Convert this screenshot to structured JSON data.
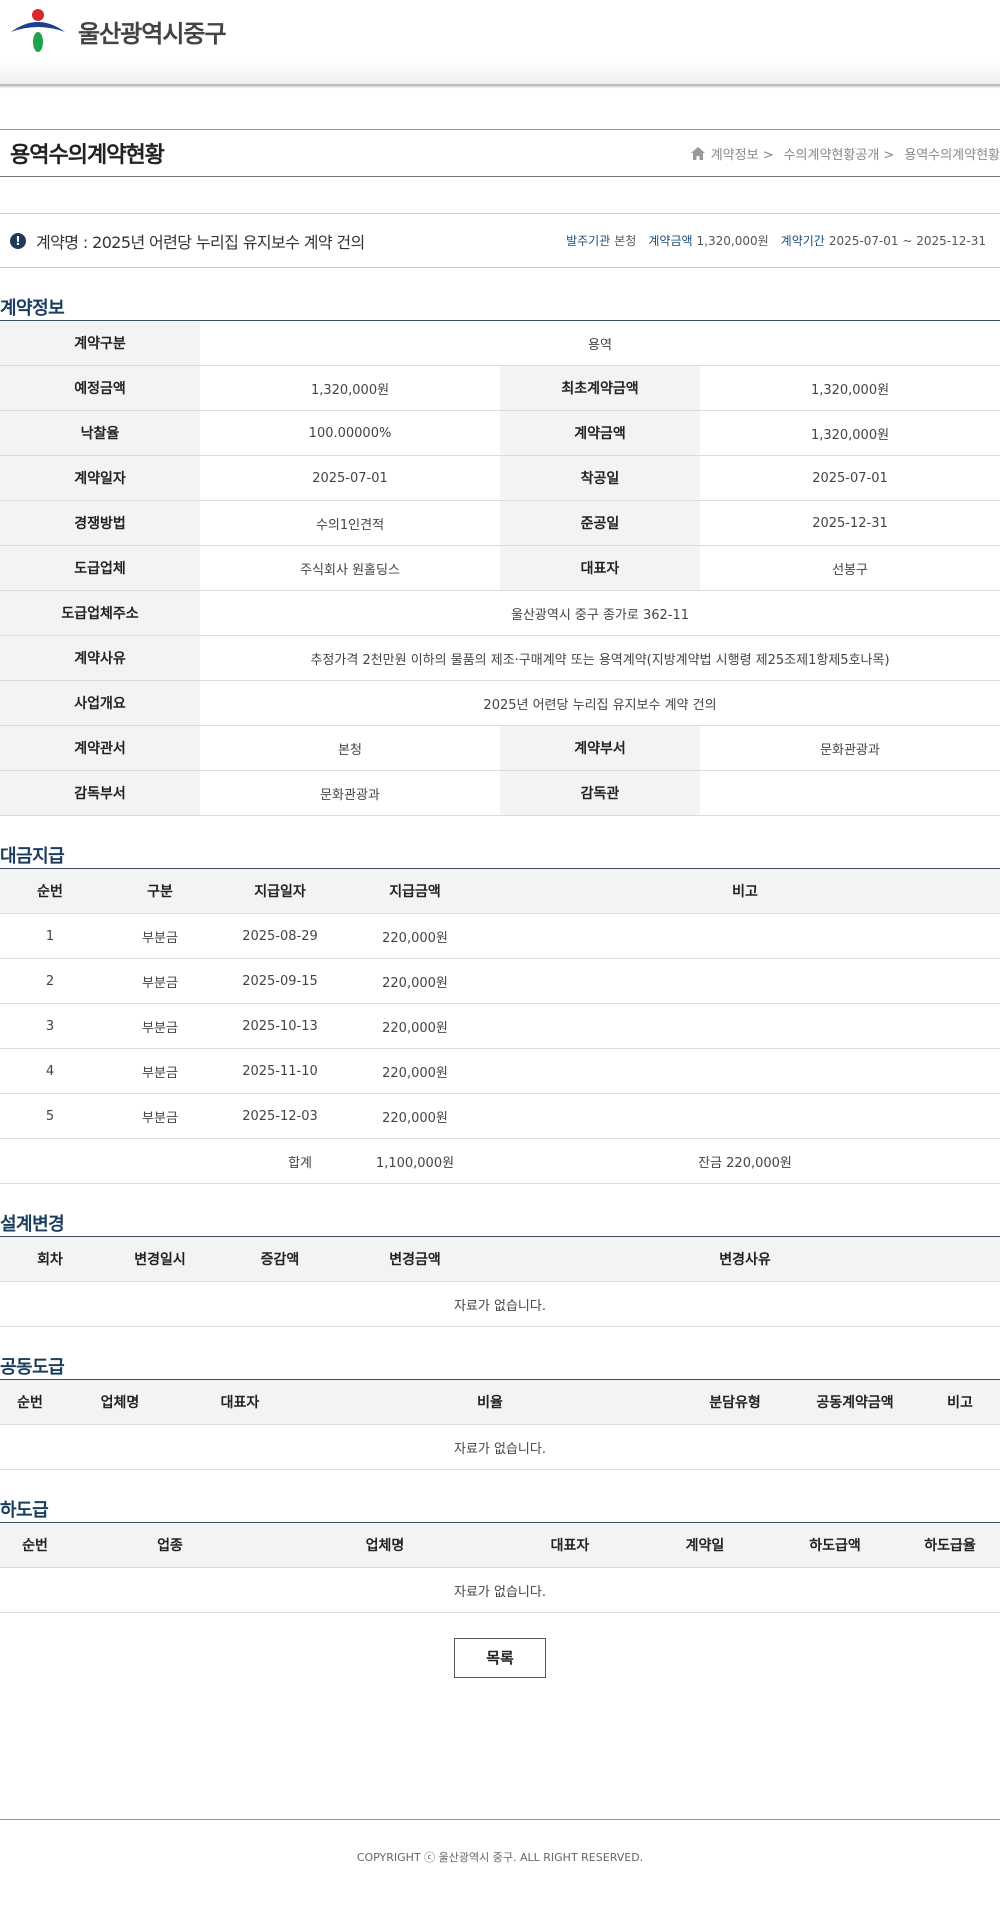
{
  "header": {
    "site_name": "울산광역시중구"
  },
  "page": {
    "title": "용역수의계약현황",
    "breadcrumb": [
      "계약정보 >",
      "수의계약현황공개 >",
      "용역수의계약현황"
    ]
  },
  "summary": {
    "title": "계약명 : 2025년 어련당 누리집 유지보수 계약 건의",
    "agency_label": "발주기관",
    "agency": "본청",
    "amount_label": "계약금액",
    "amount": "1,320,000원",
    "period_label": "계약기간",
    "period": "2025-07-01 ~ 2025-12-31"
  },
  "contract_info": {
    "title": "계약정보",
    "rows": [
      [
        {
          "label": "계약구분",
          "value": "용역"
        }
      ],
      [
        {
          "label": "예정금액",
          "value": "1,320,000원"
        },
        {
          "label": "최초계약금액",
          "value": "1,320,000원"
        }
      ],
      [
        {
          "label": "낙찰율",
          "value": "100.00000%"
        },
        {
          "label": "계약금액",
          "value": "1,320,000원"
        }
      ],
      [
        {
          "label": "계약일자",
          "value": "2025-07-01"
        },
        {
          "label": "착공일",
          "value": "2025-07-01"
        }
      ],
      [
        {
          "label": "경쟁방법",
          "value": "수의1인견적"
        },
        {
          "label": "준공일",
          "value": "2025-12-31"
        }
      ],
      [
        {
          "label": "도급업체",
          "value": "주식회사 원홀딩스"
        },
        {
          "label": "대표자",
          "value": "선봉구"
        }
      ],
      [
        {
          "label": "도급업체주소",
          "value": "울산광역시 중구 종가로 362-11"
        }
      ],
      [
        {
          "label": "계약사유",
          "value": "추정가격 2천만원 이하의 물품의 제조·구매계약 또는 용역계약(지방계약법 시행령 제25조제1항제5호나목)"
        }
      ],
      [
        {
          "label": "사업개요",
          "value": "2025년 어련당 누리집 유지보수 계약 건의"
        }
      ],
      [
        {
          "label": "계약관서",
          "value": "본청"
        },
        {
          "label": "계약부서",
          "value": "문화관광과"
        }
      ],
      [
        {
          "label": "감독부서",
          "value": "문화관광과"
        },
        {
          "label": "감독관",
          "value": ""
        }
      ]
    ]
  },
  "payments": {
    "title": "대금지급",
    "headers": [
      "순번",
      "구분",
      "지급일자",
      "지급금액",
      "비고"
    ],
    "rows": [
      [
        "1",
        "부분금",
        "2025-08-29",
        "220,000원",
        ""
      ],
      [
        "2",
        "부분금",
        "2025-09-15",
        "220,000원",
        ""
      ],
      [
        "3",
        "부분금",
        "2025-10-13",
        "220,000원",
        ""
      ],
      [
        "4",
        "부분금",
        "2025-11-10",
        "220,000원",
        ""
      ],
      [
        "5",
        "부분금",
        "2025-12-03",
        "220,000원",
        ""
      ]
    ],
    "total_label": "합계",
    "total_amount": "1,100,000원",
    "balance": "잔금 220,000원"
  },
  "design_change": {
    "title": "설계변경",
    "headers": [
      "회차",
      "변경일시",
      "증감액",
      "변경금액",
      "변경사유"
    ],
    "empty": "자료가 없습니다."
  },
  "joint_contract": {
    "title": "공동도급",
    "headers": [
      "순번",
      "업체명",
      "대표자",
      "비율",
      "분담유형",
      "공동계약금액",
      "비고"
    ],
    "empty": "자료가 없습니다."
  },
  "subcontract": {
    "title": "하도급",
    "headers": [
      "순번",
      "업종",
      "업체명",
      "대표자",
      "계약일",
      "하도급액",
      "하도급율"
    ],
    "empty": "자료가 없습니다."
  },
  "buttons": {
    "list": "목록"
  },
  "footer": {
    "copyright": "COPYRIGHT ⓒ 울산광역시 중구. ALL RIGHT RESERVED."
  }
}
